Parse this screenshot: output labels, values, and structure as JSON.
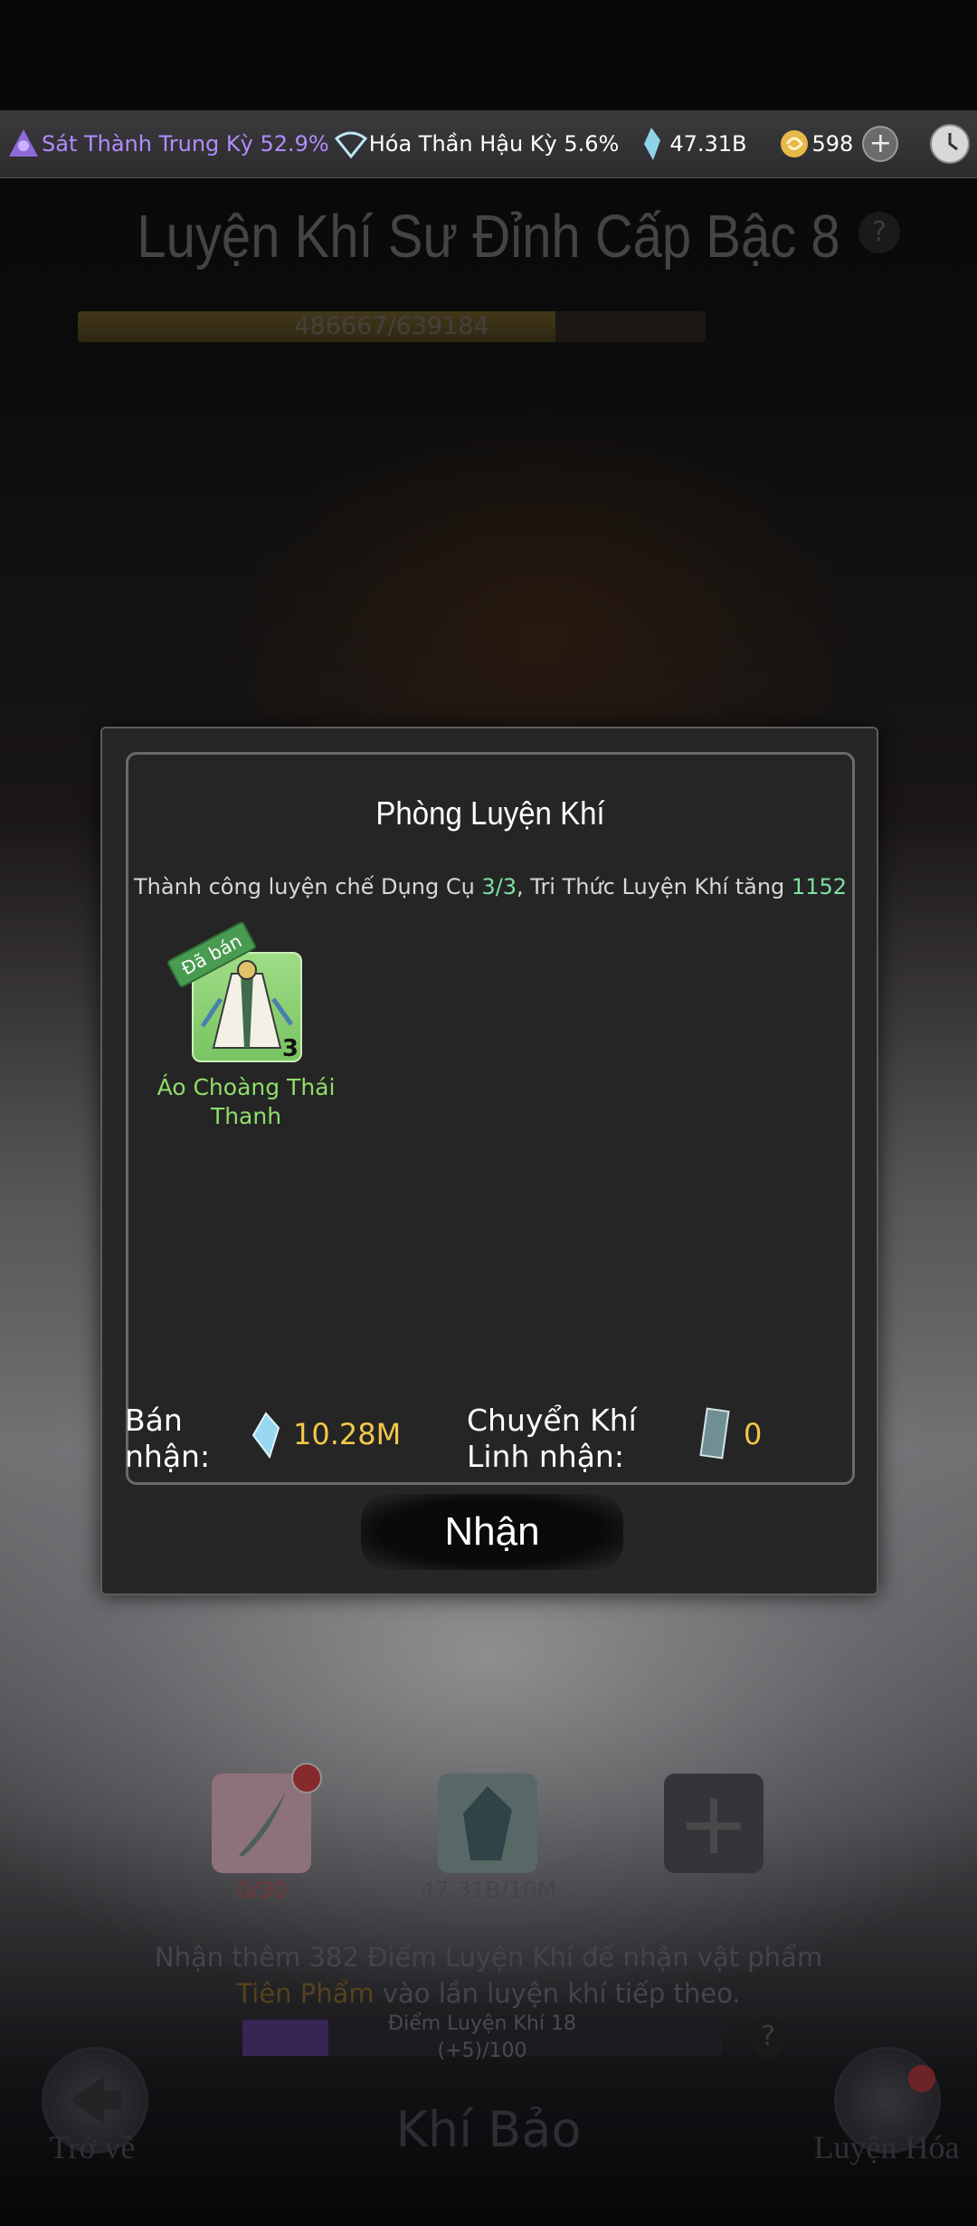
{
  "topbar": {
    "realm1": "Sát Thành Trung Kỳ 52.9%",
    "realm2": "Hóa Thần Hậu Kỳ 5.6%",
    "crystals": "47.31B",
    "coins": "598",
    "plus": "+"
  },
  "background": {
    "title": "Luyện Khí Sư Đỉnh Cấp Bậc 8",
    "help": "?",
    "progress_text": "486667/639184",
    "progress_fraction": 0.761,
    "slot1_label": "0/30",
    "slot2_label": "47.31B/10M",
    "slot3_plus": "+",
    "msg_line1": "Nhận thêm 382 Điểm Luyện Khí để nhận vật phẩm",
    "msg_line2_highlight": "Tiên Phẩm",
    "msg_line2_rest": " vào lần luyện khí tiếp theo.",
    "points_line1": "Điểm Luyện Khí 18",
    "points_line2": "(+5)/100",
    "points_fraction": 0.18,
    "back_label": "Trở về",
    "refine_label": "Luyện Hóa",
    "section_title": "Khí Bảo"
  },
  "dialog": {
    "title": "Phòng Luyện Khí",
    "msg_prefix": "Thành công luyện chế Dụng Cụ ",
    "msg_count": "3/3",
    "msg_middle": ", Tri Thức Luyện Khí tăng ",
    "msg_value": "1152",
    "item": {
      "badge": "Đã bán",
      "qty": "3",
      "name": "Áo Choàng Thái Thanh"
    },
    "sell_label": "Bán nhận:",
    "sell_value": "10.28M",
    "transfer_label": "Chuyển Khí Linh nhận:",
    "transfer_value": "0",
    "confirm_button": "Nhận"
  },
  "colors": {
    "accent_green": "#7ee0a0",
    "item_name_green": "#8fdd6a",
    "gold": "#f2c84a",
    "realm_purple": "#b18cff"
  }
}
